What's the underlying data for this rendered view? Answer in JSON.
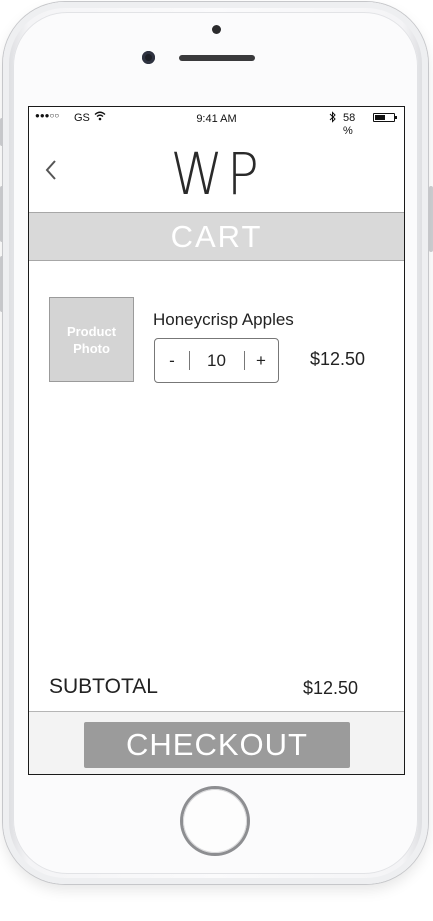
{
  "status_bar": {
    "signal": "●●●○○",
    "carrier": "GS",
    "time": "9:41 AM",
    "battery_percent": "58 %",
    "battery_level": 0.58
  },
  "header": {
    "logo": "WP",
    "back_icon": "chevron-left-icon"
  },
  "page_title": "CART",
  "cart": {
    "items": [
      {
        "photo_label": "Product Photo",
        "name": "Honeycrisp Apples",
        "quantity": "10",
        "decrement": "-",
        "increment": "+",
        "price": "$12.50"
      }
    ]
  },
  "summary": {
    "subtotal_label": "SUBTOTAL",
    "subtotal_value": "$12.50"
  },
  "footer": {
    "checkout_label": "CHECKOUT"
  },
  "colors": {
    "title_band": "#d9d9d9",
    "checkout_button": "#9b9b9b",
    "photo_placeholder": "#d4d4d4"
  }
}
